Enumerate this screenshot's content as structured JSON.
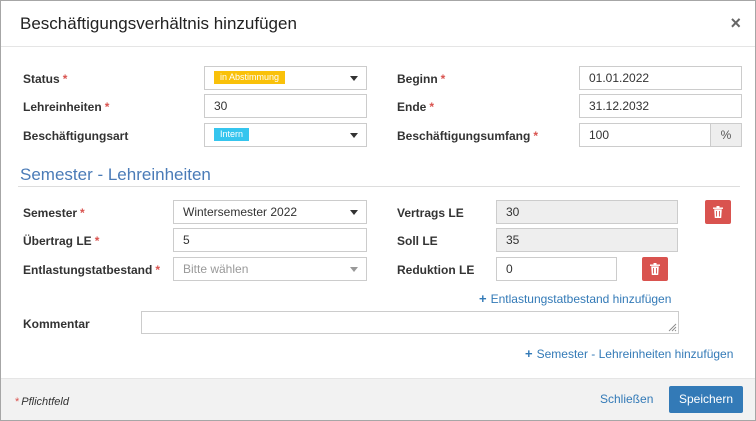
{
  "dialog": {
    "title": "Beschäftigungsverhältnis hinzufügen",
    "close_symbol": "×"
  },
  "required_marker": "*",
  "form": {
    "status": {
      "label": "Status",
      "value": "in Abstimmung",
      "badge_color": "#f9c10a"
    },
    "lehreinheiten": {
      "label": "Lehreinheiten",
      "value": "30"
    },
    "beschaeftigungsart": {
      "label": "Beschäftigungsart",
      "value": "Intern",
      "badge_color": "#35c5ee"
    },
    "beginn": {
      "label": "Beginn",
      "value": "01.01.2022"
    },
    "ende": {
      "label": "Ende",
      "value": "31.12.2032"
    },
    "beschaeftigungsumfang": {
      "label": "Beschäftigungsumfang",
      "value": "100",
      "unit": "%"
    }
  },
  "semester_section": {
    "title": "Semester - Lehreinheiten",
    "semester": {
      "label": "Semester",
      "value": "Wintersemester 2022"
    },
    "uebertrag_le": {
      "label": "Übertrag LE",
      "value": "5"
    },
    "entlastungstatbestand": {
      "label": "Entlastungstatbestand",
      "placeholder": "Bitte wählen"
    },
    "vertrags_le": {
      "label": "Vertrags LE",
      "value": "30"
    },
    "soll_le": {
      "label": "Soll LE",
      "value": "35"
    },
    "reduktion_le": {
      "label": "Reduktion LE",
      "value": "0"
    },
    "add_entlastung_link": "Entlastungstatbestand hinzufügen",
    "kommentar": {
      "label": "Kommentar",
      "value": ""
    },
    "add_semester_link": "Semester - Lehreinheiten hinzufügen"
  },
  "footer": {
    "required_note": "Pflichtfeld",
    "close_label": "Schließen",
    "save_label": "Speichern"
  },
  "colors": {
    "accent": "#337ab7",
    "danger": "#d9534f",
    "section_title": "#4a7bb7"
  },
  "icons": {
    "delete": "trash-icon",
    "add": "plus-icon",
    "close": "close-icon",
    "dropdown": "chevron-down-icon"
  }
}
